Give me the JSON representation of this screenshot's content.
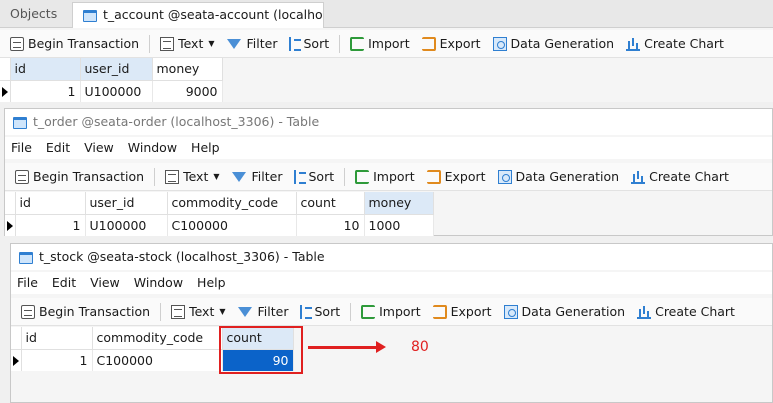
{
  "tabs": [
    {
      "label": "Objects"
    },
    {
      "label": "t_account @seata-account (localhost_3306) - Table"
    }
  ],
  "toolbar": {
    "begin_transaction": "Begin Transaction",
    "text": "Text",
    "filter": "Filter",
    "sort": "Sort",
    "import": "Import",
    "export": "Export",
    "data_generation": "Data Generation",
    "create_chart": "Create Chart"
  },
  "menu": [
    "File",
    "Edit",
    "View",
    "Window",
    "Help"
  ],
  "account": {
    "columns": [
      "id",
      "user_id",
      "money"
    ],
    "row": {
      "id": "1",
      "user_id": "U100000",
      "money": "9000"
    }
  },
  "order": {
    "title": "t_order @seata-order (localhost_3306) - Table",
    "columns": [
      "id",
      "user_id",
      "commodity_code",
      "count",
      "money"
    ],
    "row": {
      "id": "1",
      "user_id": "U100000",
      "commodity_code": "C100000",
      "count": "10",
      "money": "1000"
    }
  },
  "stock": {
    "title": "t_stock @seata-stock (localhost_3306) - Table",
    "columns": [
      "id",
      "commodity_code",
      "count"
    ],
    "row": {
      "id": "1",
      "commodity_code": "C100000",
      "count": "90"
    }
  },
  "annotation": {
    "value": "80",
    "color": "#e02020"
  },
  "colors": {
    "accent": "#0b63c9",
    "icon_blue": "#2f7fd1"
  }
}
